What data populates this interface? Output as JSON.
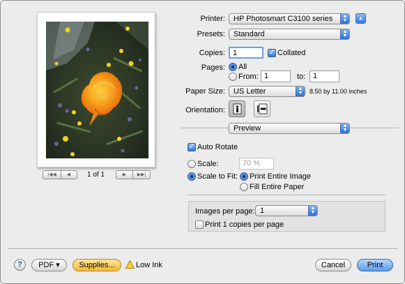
{
  "printer": {
    "label": "Printer:",
    "value": "HP Photosmart C3100 series"
  },
  "presets": {
    "label": "Presets:",
    "value": "Standard"
  },
  "copies": {
    "label": "Copies:",
    "value": "1",
    "collated_label": "Collated",
    "collated": true
  },
  "pages": {
    "label": "Pages:",
    "all_label": "All",
    "from_label": "From:",
    "from_value": "1",
    "to_label": "to:",
    "to_value": "1",
    "selected": "all"
  },
  "paper_size": {
    "label": "Paper Size:",
    "value": "US Letter",
    "dimensions": "8.50 by 11.00 inches"
  },
  "orientation": {
    "label": "Orientation:",
    "selected": "portrait"
  },
  "section_popup": {
    "value": "Preview"
  },
  "auto_rotate": {
    "label": "Auto Rotate",
    "checked": true
  },
  "scale": {
    "label": "Scale:",
    "value": "70 %"
  },
  "scale_to_fit": {
    "label": "Scale to Fit:",
    "print_entire_image": "Print Entire Image",
    "fill_entire_paper": "Fill Entire Paper",
    "selected": "print_entire_image"
  },
  "images_per_page": {
    "label": "Images per page:",
    "value": "1"
  },
  "print_copies_per_page": {
    "label": "Print 1 copies per page",
    "checked": false
  },
  "preview_nav": {
    "page_indicator": "1 of 1"
  },
  "bottom": {
    "help_label": "?",
    "pdf_label": "PDF ▾",
    "supplies_label": "Supplies...",
    "low_ink_label": "Low Ink",
    "cancel_label": "Cancel",
    "print_label": "Print"
  },
  "colors": {
    "accent": "#3a78d6",
    "poppy": "#f28c0f",
    "dialog_bg": "#ececec"
  }
}
